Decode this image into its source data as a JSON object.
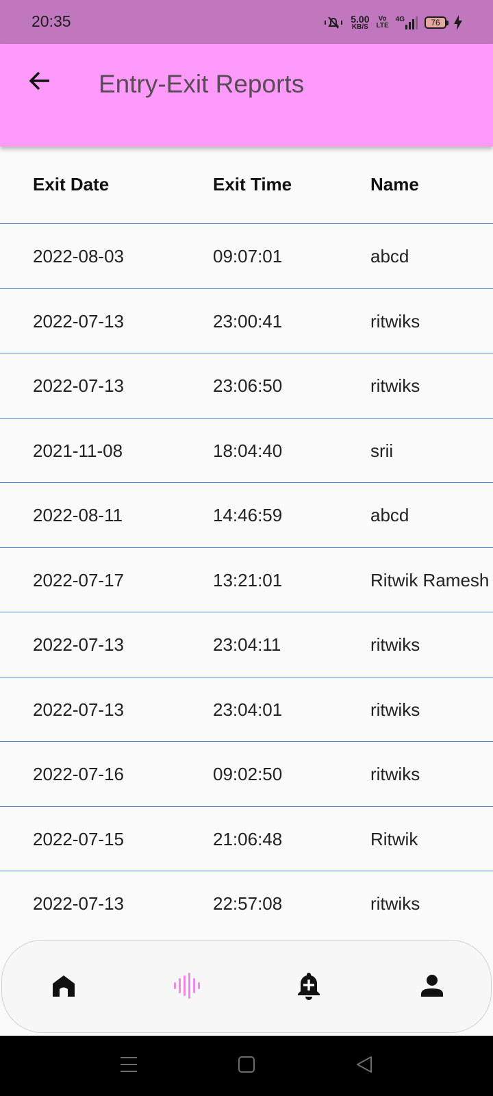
{
  "status_bar": {
    "time": "20:35",
    "net_speed_value": "5.00",
    "net_speed_unit": "KB/S",
    "volte_top": "Vo",
    "volte_bottom": "LTE",
    "network": "4G",
    "battery_level": "76",
    "icons": [
      "mute-icon",
      "signal-icon",
      "battery-icon",
      "charging-icon"
    ]
  },
  "app_bar": {
    "title": "Entry-Exit Reports",
    "back_icon": "arrow-left-icon",
    "background": "#fe9afa"
  },
  "table": {
    "columns": [
      "Exit Date",
      "Exit Time",
      "Name"
    ],
    "rows": [
      [
        "2022-08-03",
        "09:07:01",
        "abcd"
      ],
      [
        "2022-07-13",
        "23:00:41",
        "ritwiks"
      ],
      [
        "2022-07-13",
        "23:06:50",
        "ritwiks"
      ],
      [
        "2021-11-08",
        "18:04:40",
        "srii"
      ],
      [
        "2022-08-11",
        "14:46:59",
        "abcd"
      ],
      [
        "2022-07-17",
        "13:21:01",
        "Ritwik Ramesh"
      ],
      [
        "2022-07-13",
        "23:04:11",
        "ritwiks"
      ],
      [
        "2022-07-13",
        "23:04:01",
        "ritwiks"
      ],
      [
        "2022-07-16",
        "09:02:50",
        "ritwiks"
      ],
      [
        "2022-07-15",
        "21:06:48",
        "Ritwik"
      ],
      [
        "2022-07-13",
        "22:57:08",
        "ritwiks"
      ]
    ],
    "divider_color": "#4a86d8"
  },
  "bottom_nav": {
    "items": [
      "home-icon",
      "reports-icon",
      "add-alert-icon",
      "profile-icon"
    ],
    "active": "reports-icon",
    "active_color": "#f08ae6"
  },
  "system_nav": [
    "menu-icon",
    "home-square-icon",
    "back-triangle-icon"
  ]
}
